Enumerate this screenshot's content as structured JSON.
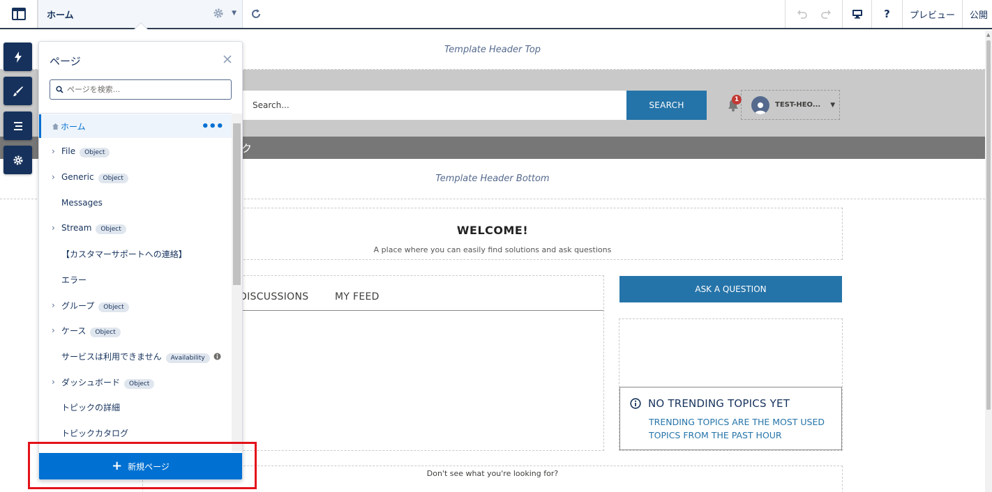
{
  "topbar": {
    "page_name": "ホーム",
    "preview_label": "プレビュー",
    "publish_label": "公開"
  },
  "template": {
    "header_top_label": "Template Header Top",
    "header_bottom_label": "Template Header Bottom",
    "search_placeholder": "Search...",
    "search_button": "SEARCH",
    "notification_count": "1",
    "user_name": "TEST-HEO...",
    "nav_fragment": "ク",
    "welcome_title": "WELCOME!",
    "welcome_subtitle": "A place where you can easily find solutions and ask questions",
    "tabs": [
      "DISCUSSIONS",
      "MY FEED"
    ],
    "ask_button": "ASK A QUESTION",
    "trending_title": "NO TRENDING TOPICS YET",
    "trending_body_line1": "TRENDING TOPICS ARE THE MOST USED",
    "trending_body_line2": "TOPICS FROM THE PAST HOUR",
    "bottom_text": "Don't see what you're looking for?"
  },
  "panel": {
    "title": "ページ",
    "search_placeholder": "ページを検索...",
    "items": [
      {
        "label": "ホーム",
        "active": true
      },
      {
        "label": "File",
        "badge": "Object",
        "expandable": true
      },
      {
        "label": "Generic",
        "badge": "Object",
        "expandable": true
      },
      {
        "label": "Messages"
      },
      {
        "label": "Stream",
        "badge": "Object",
        "expandable": true
      },
      {
        "label": "【カスタマーサポートへの連絡】"
      },
      {
        "label": "エラー"
      },
      {
        "label": "グループ",
        "badge": "Object",
        "expandable": true
      },
      {
        "label": "ケース",
        "badge": "Object",
        "expandable": true
      },
      {
        "label": "サービスは利用できません",
        "badge": "Availability",
        "info": true
      },
      {
        "label": "ダッシュボード",
        "badge": "Object",
        "expandable": true
      },
      {
        "label": "トピックの詳細"
      },
      {
        "label": "トピックカタログ"
      }
    ],
    "new_page_label": "新規ページ"
  },
  "colors": {
    "brand_blue": "#0070d2",
    "template_blue": "#2574a9",
    "rail_navy": "#16325c",
    "highlight_red": "#e3121a"
  },
  "icons": {
    "app": "layout-icon",
    "settings": "gear-icon",
    "refresh": "refresh-icon",
    "undo": "undo-icon",
    "redo": "redo-icon",
    "device": "desktop-icon",
    "help": "question-icon",
    "rail": [
      "lightning-icon",
      "brush-icon",
      "list-icon",
      "gear-icon"
    ]
  }
}
